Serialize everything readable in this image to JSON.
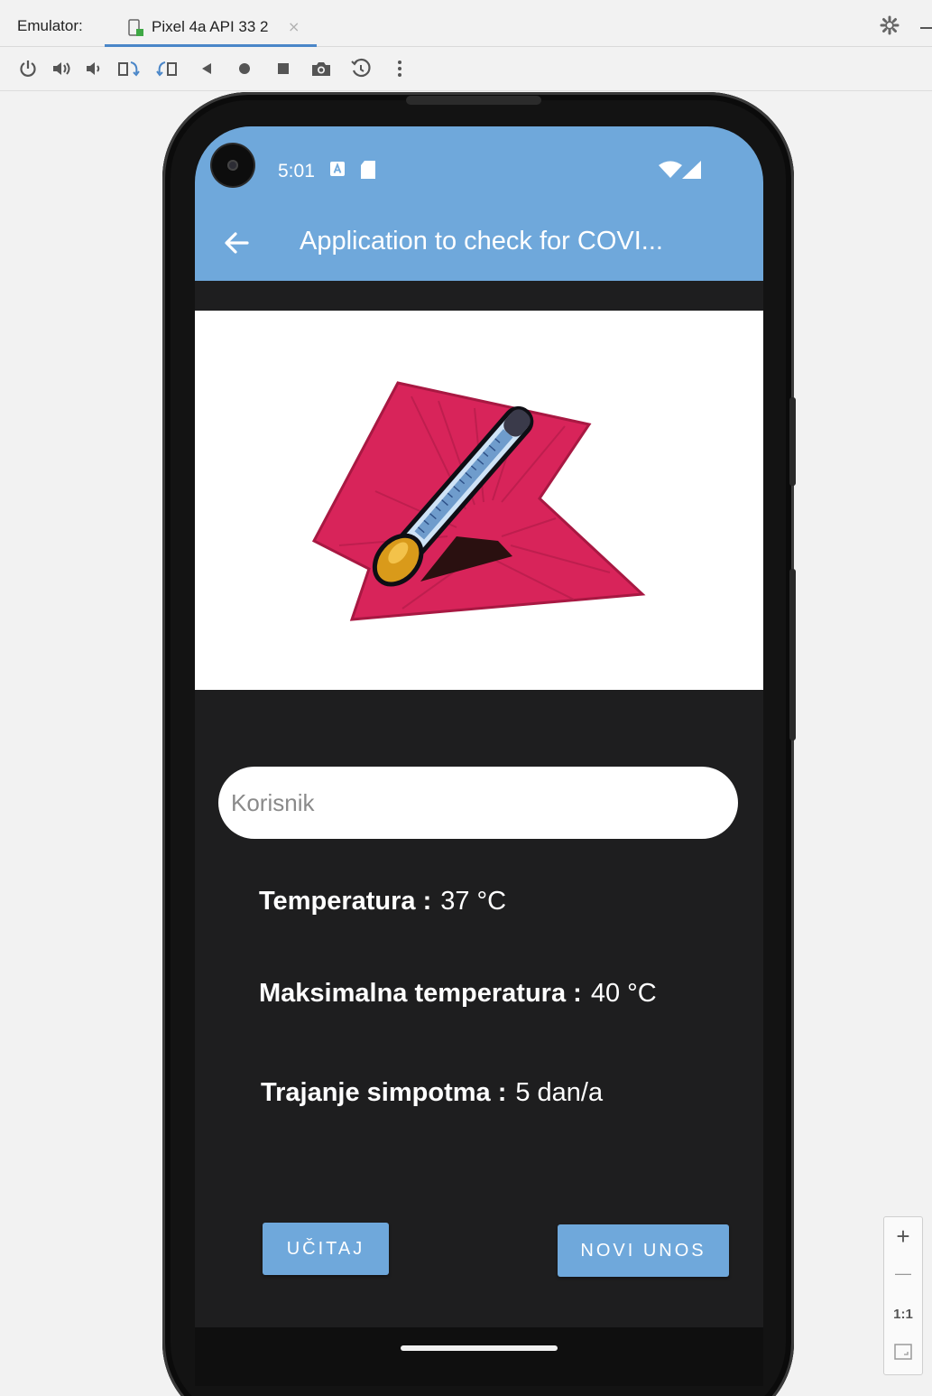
{
  "tool_window": {
    "label": "Emulator:",
    "tab_title": "Pixel 4a API 33 2",
    "tab_close": "×"
  },
  "toolbar": {
    "icons": [
      "power-icon",
      "volume-up-icon",
      "volume-down-icon",
      "rotate-left-icon",
      "rotate-right-icon",
      "back-icon",
      "home-icon",
      "overview-icon",
      "screenshot-icon",
      "snapshot-icon",
      "more-icon"
    ]
  },
  "status_bar": {
    "time": "5:01"
  },
  "app_bar": {
    "back_glyph": "←",
    "title": "Application to check for COVI..."
  },
  "form": {
    "user_placeholder": "Korisnik",
    "temperature_label": "Temperatura :",
    "temperature_value": "37 °C",
    "max_temperature_label": "Maksimalna temperatura :",
    "max_temperature_value": "40 °C",
    "duration_label": "Trajanje simpotma :",
    "duration_value": "5 dan/a"
  },
  "buttons": {
    "load_label": "UČITAJ",
    "new_entry_label": "NOVI UNOS"
  },
  "zoom_controls": {
    "zoom_in": "+",
    "zoom_out": "—",
    "actual_size": "1:1"
  },
  "colors": {
    "accent": "#6fa8db",
    "screen_background": "#1e1e1f",
    "thermometer_backdrop": "#d8245a"
  }
}
